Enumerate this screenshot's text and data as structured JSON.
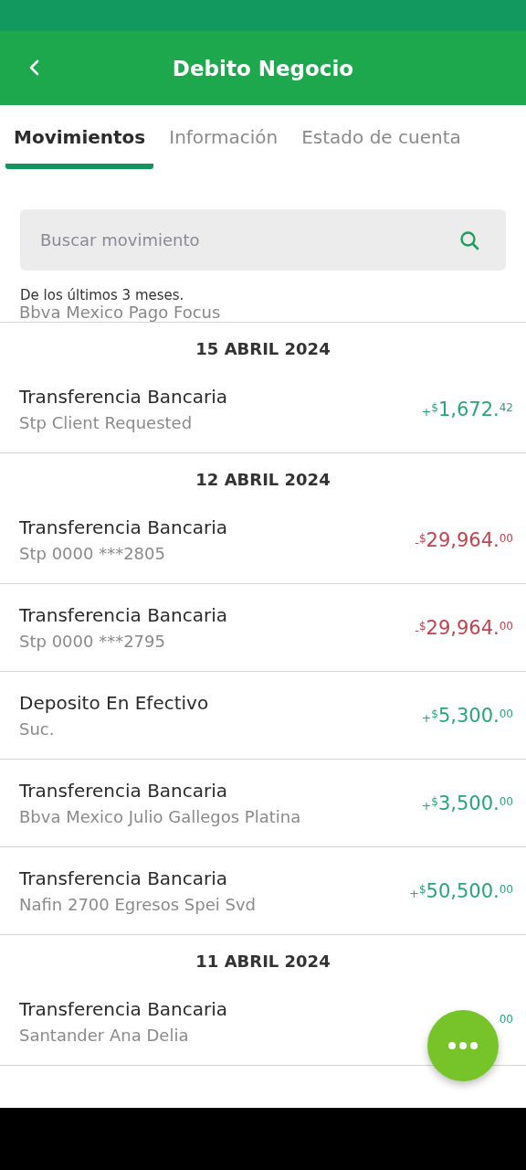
{
  "header": {
    "title": "Debito Negocio"
  },
  "tabs": [
    {
      "label": "Movimientos",
      "selected": true
    },
    {
      "label": "Información",
      "selected": false
    },
    {
      "label": "Estado de cuenta",
      "selected": false
    }
  ],
  "search": {
    "placeholder": "Buscar movimiento"
  },
  "note": "De los últimos 3 meses.",
  "clipped_row": "Bbva Mexico Pago Focus",
  "sections": [
    {
      "date": "15 ABRIL 2024",
      "rows": [
        {
          "title": "Transferencia Bancaria",
          "detail": "Stp Client Requested",
          "amount": {
            "kind": "credit",
            "sign": "+",
            "currency": "$",
            "whole": "1,672.",
            "cents": "42"
          }
        }
      ]
    },
    {
      "date": "12 ABRIL 2024",
      "rows": [
        {
          "title": "Transferencia Bancaria",
          "detail": "Stp 0000 ***2805",
          "amount": {
            "kind": "debit",
            "sign": "-",
            "currency": "$",
            "whole": "29,964.",
            "cents": "00"
          }
        },
        {
          "title": "Transferencia Bancaria",
          "detail": "Stp 0000 ***2795",
          "amount": {
            "kind": "debit",
            "sign": "-",
            "currency": "$",
            "whole": "29,964.",
            "cents": "00"
          }
        },
        {
          "title": "Deposito En Efectivo",
          "detail": "Suc.",
          "amount": {
            "kind": "credit",
            "sign": "+",
            "currency": "$",
            "whole": "5,300.",
            "cents": "00"
          }
        },
        {
          "title": "Transferencia Bancaria",
          "detail": "Bbva Mexico Julio Gallegos Platina",
          "amount": {
            "kind": "credit",
            "sign": "+",
            "currency": "$",
            "whole": "3,500.",
            "cents": "00"
          }
        },
        {
          "title": "Transferencia Bancaria",
          "detail": "Nafin 2700 Egresos Spei Svd",
          "amount": {
            "kind": "credit",
            "sign": "+",
            "currency": "$",
            "whole": "50,500.",
            "cents": "00"
          }
        }
      ]
    },
    {
      "date": "11 ABRIL 2024",
      "rows": [
        {
          "title": "Transferencia Bancaria",
          "detail": "Santander Ana Delia",
          "amount": {
            "kind": "credit",
            "cents": "00"
          }
        }
      ]
    }
  ]
}
